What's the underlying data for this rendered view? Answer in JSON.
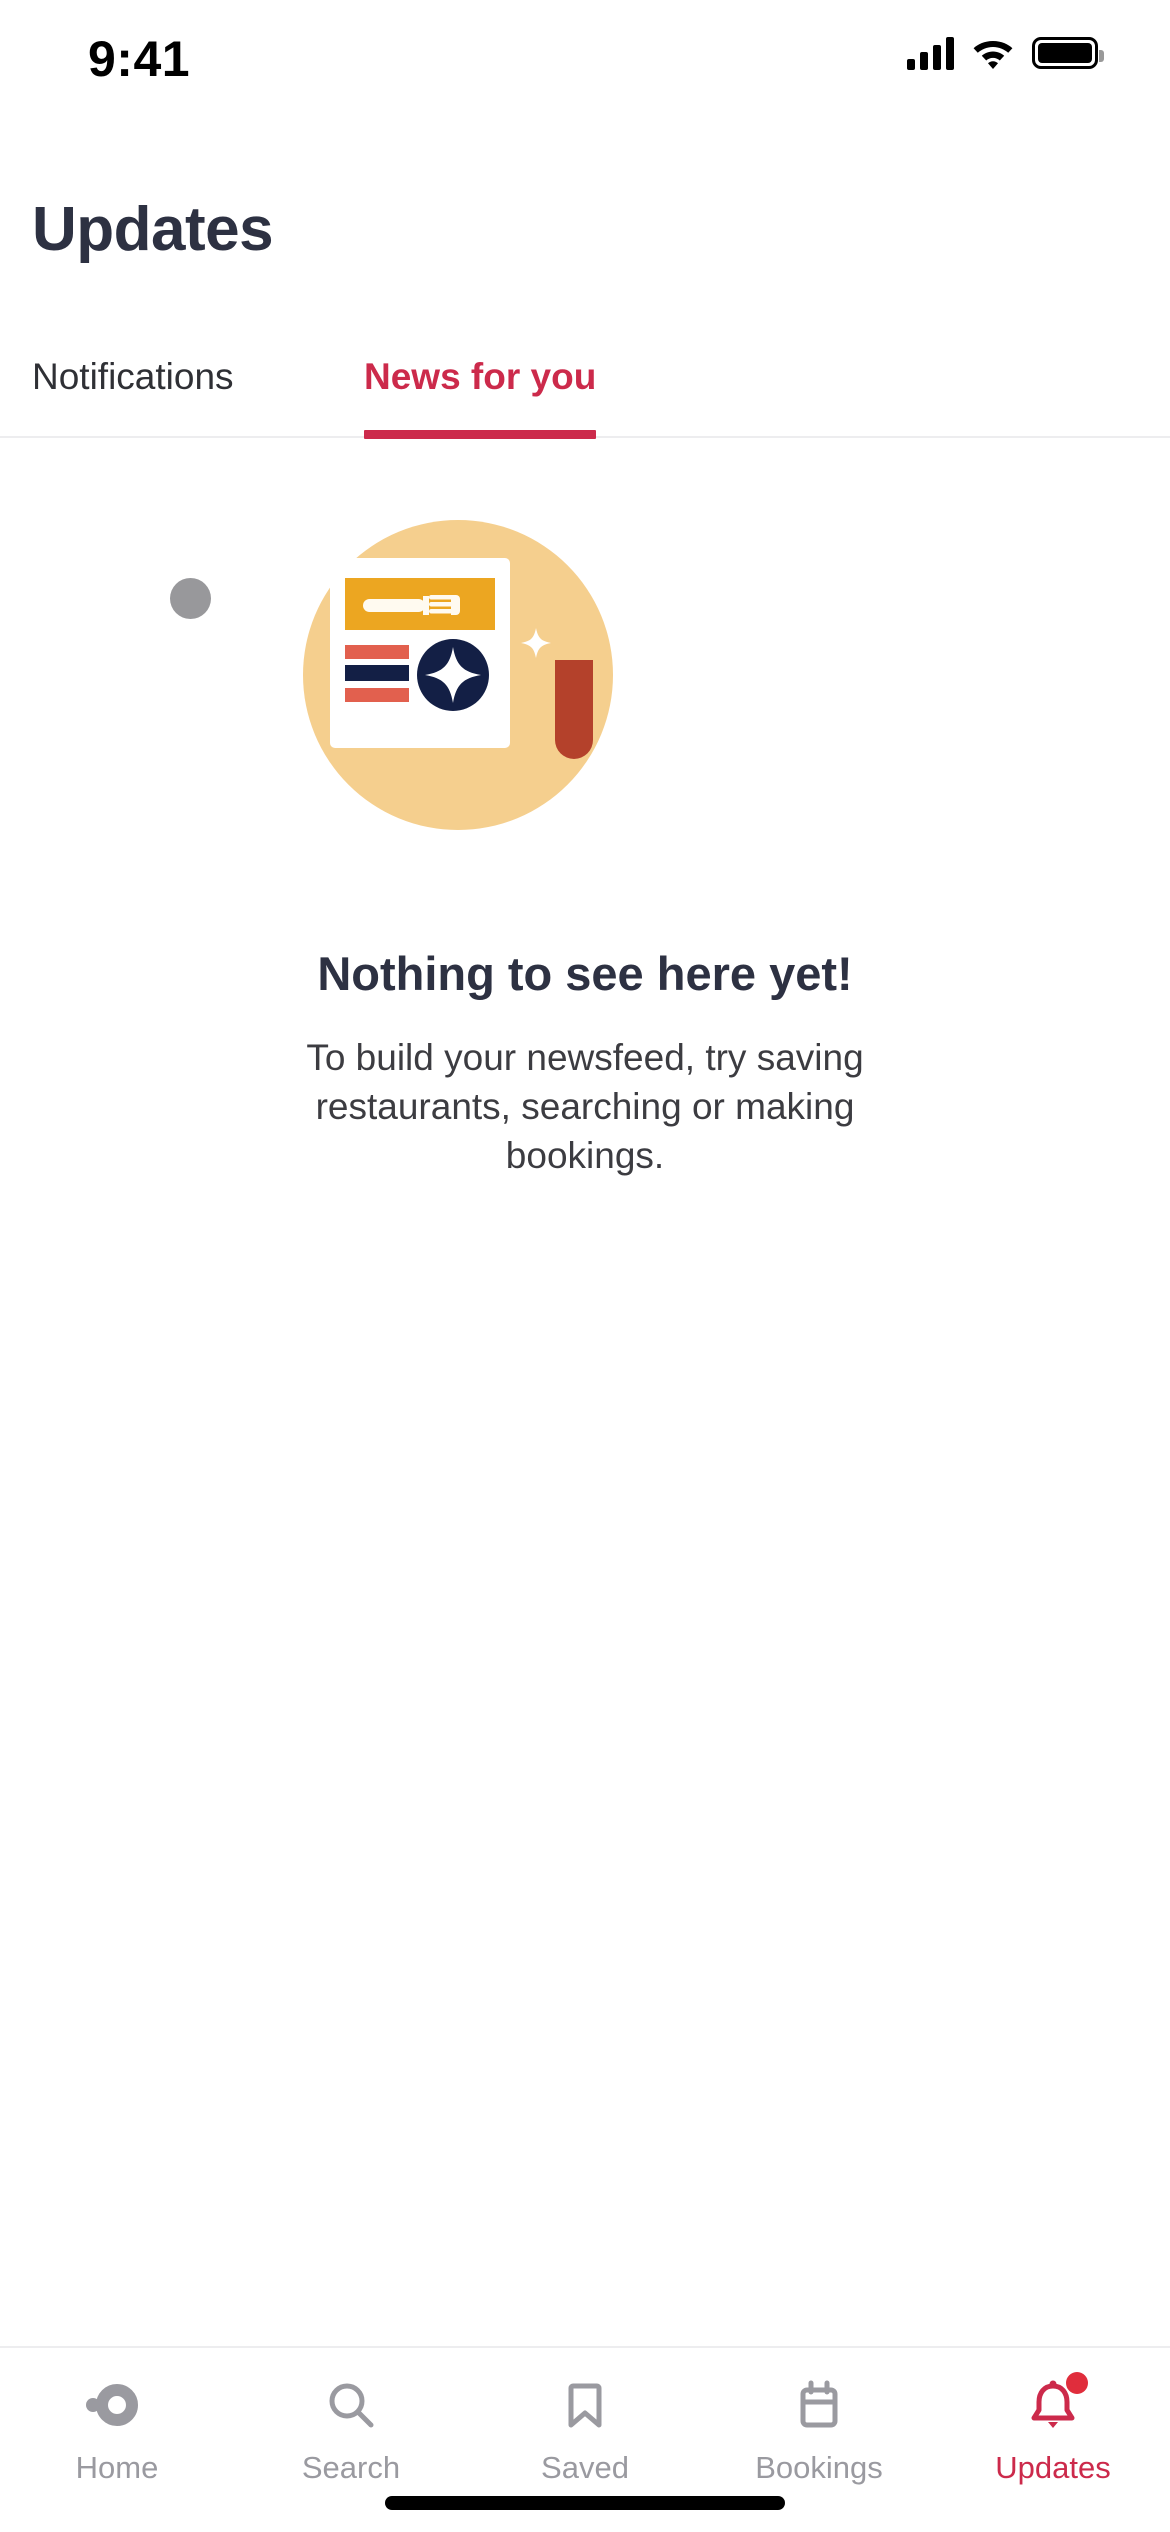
{
  "status_bar": {
    "time": "9:41",
    "cellular_icon": "cellular-bars-icon",
    "wifi_icon": "wifi-icon",
    "battery_icon": "battery-full-icon"
  },
  "header": {
    "title": "Updates"
  },
  "tabs": {
    "items": [
      {
        "label": "Notifications",
        "active": false
      },
      {
        "label": "News for you",
        "active": true
      }
    ],
    "active_color": "#cc2a4b",
    "inactive_color": "#2f3035"
  },
  "empty_state": {
    "illustration_name": "newsfeed-empty-illustration",
    "title": "Nothing to see here yet!",
    "body": "To build your newsfeed, try saving restaurants, searching or making bookings.",
    "colors": {
      "circle": "#f5cf8e",
      "card": "#ffffff",
      "banner": "#eca621",
      "stripe_red": "#e2604e",
      "stripe_navy": "#131f45",
      "badge_navy": "#131f45",
      "bookmark": "#b4412b",
      "gray_dot": "#98989b"
    }
  },
  "bottom_nav": {
    "items": [
      {
        "label": "Home",
        "icon": "home-icon",
        "active": false
      },
      {
        "label": "Search",
        "icon": "search-icon",
        "active": false
      },
      {
        "label": "Saved",
        "icon": "bookmark-icon",
        "active": false
      },
      {
        "label": "Bookings",
        "icon": "calendar-icon",
        "active": false
      },
      {
        "label": "Updates",
        "icon": "bell-icon",
        "active": true,
        "badge": true
      }
    ],
    "active_color": "#cc2a4b",
    "inactive_color": "#9a9aa0",
    "badge_color": "#e02d3c"
  }
}
